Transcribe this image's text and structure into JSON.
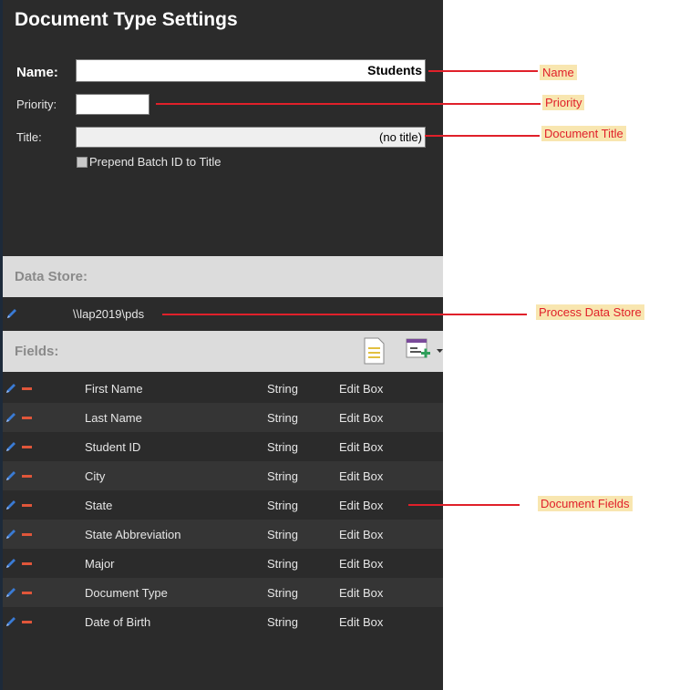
{
  "panel": {
    "title": "Document Type Settings",
    "name_label": "Name:",
    "name_value": "Students",
    "priority_label": "Priority:",
    "priority_value": "",
    "title_label": "Title:",
    "title_value": "(no title)",
    "prepend_label": "Prepend Batch ID to Title",
    "data_store_label": "Data Store:",
    "data_store_path": "\\\\lap2019\\pds",
    "fields_label": "Fields:"
  },
  "fields": [
    {
      "name": "First Name",
      "type": "String",
      "control": "Edit Box"
    },
    {
      "name": "Last Name",
      "type": "String",
      "control": "Edit Box"
    },
    {
      "name": "Student ID",
      "type": "String",
      "control": "Edit Box"
    },
    {
      "name": "City",
      "type": "String",
      "control": "Edit Box"
    },
    {
      "name": "State",
      "type": "String",
      "control": "Edit Box"
    },
    {
      "name": "State Abbreviation",
      "type": "String",
      "control": "Edit Box"
    },
    {
      "name": "Major",
      "type": "String",
      "control": "Edit Box"
    },
    {
      "name": "Document Type",
      "type": "String",
      "control": "Edit Box"
    },
    {
      "name": "Date of Birth",
      "type": "String",
      "control": "Edit Box"
    }
  ],
  "annotations": {
    "name": "Name",
    "priority": "Priority",
    "document_title": "Document Title",
    "process_data_store": "Process Data Store",
    "document_fields": "Document Fields"
  },
  "colors": {
    "panel_bg": "#2b2b2b",
    "section_bg": "#dcdcdc",
    "annotation_line": "#e0202a",
    "annotation_bg": "#f8e6b0",
    "remove_icon": "#e0563a",
    "edit_icon": "#3a7bd5"
  },
  "icons": [
    "pencil-icon",
    "minus-icon",
    "document-icon",
    "add-field-icon",
    "dropdown-arrow-icon",
    "checkbox-icon"
  ]
}
